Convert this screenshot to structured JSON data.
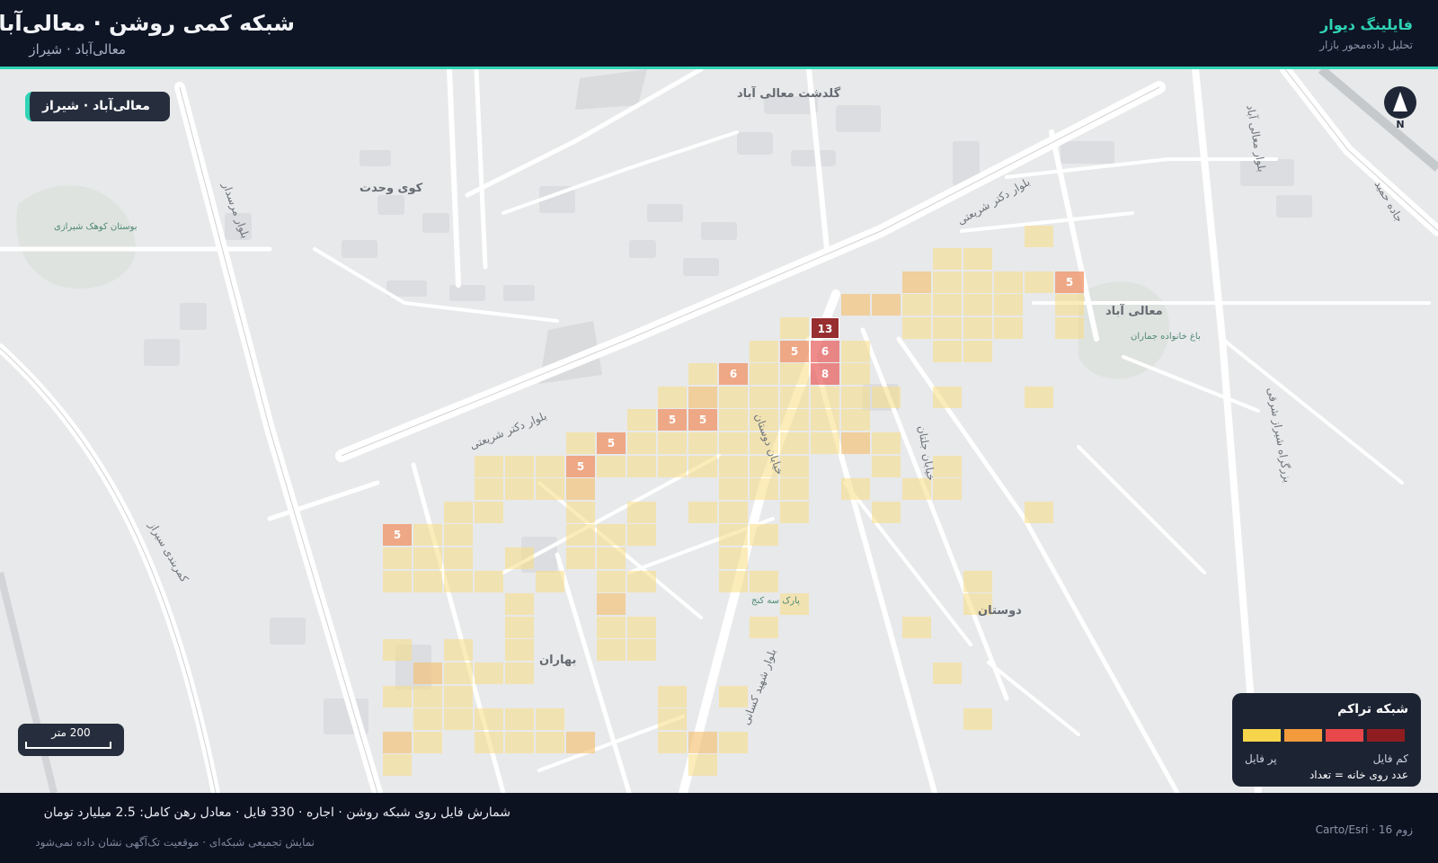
{
  "header": {
    "title": "شبکه کمی روشن · معالی‌آباد",
    "subtitle": "معالی‌آباد · شیراز",
    "brand": "فایلینگ دیوار",
    "brand_tagline": "تحلیل داده‌محور بازار"
  },
  "map": {
    "location_badge": "معالی‌آباد · شیراز",
    "north_label": "N",
    "scale_label": "200 متر",
    "place_labels": [
      {
        "text": "گلدشت معالی آباد",
        "kind": "big"
      },
      {
        "text": "کوی وحدت",
        "kind": "big"
      },
      {
        "text": "معالی آباد",
        "kind": "big"
      },
      {
        "text": "دوستان",
        "kind": "big"
      },
      {
        "text": "بهاران",
        "kind": "big"
      },
      {
        "text": "بوستان کوهک شیرازی",
        "kind": "park"
      },
      {
        "text": "باغ خانواده جماران",
        "kind": "park"
      },
      {
        "text": "پارک سه کنج",
        "kind": "park"
      },
      {
        "text": "بلوار دکتر شریعتی",
        "kind": "street"
      },
      {
        "text": "کمربندی سیراز",
        "kind": "street"
      },
      {
        "text": "بلوار مرسدار",
        "kind": "street"
      },
      {
        "text": "بلوار شهید کسانی",
        "kind": "street"
      },
      {
        "text": "خیابان دوستان",
        "kind": "street"
      },
      {
        "text": "خیابان جلتان",
        "kind": "street"
      },
      {
        "text": "بزرگراه شیراز شرقی",
        "kind": "street"
      },
      {
        "text": "بلوار معالی آباد",
        "kind": "street"
      },
      {
        "text": "بلوار دکتر شریعتی",
        "kind": "street"
      },
      {
        "text": "جاده حمید",
        "kind": "street"
      }
    ],
    "grid_cells": [
      {
        "col": 34,
        "row": 6,
        "level": 1
      },
      {
        "col": 31,
        "row": 7,
        "level": 1
      },
      {
        "col": 32,
        "row": 7,
        "level": 1
      },
      {
        "col": 30,
        "row": 8,
        "level": 2
      },
      {
        "col": 31,
        "row": 8,
        "level": 1
      },
      {
        "col": 32,
        "row": 8,
        "level": 1
      },
      {
        "col": 33,
        "row": 8,
        "level": 1
      },
      {
        "col": 34,
        "row": 8,
        "level": 1
      },
      {
        "col": 35,
        "row": 8,
        "level": 3,
        "count": 5
      },
      {
        "col": 28,
        "row": 9,
        "level": 2
      },
      {
        "col": 29,
        "row": 9,
        "level": 2
      },
      {
        "col": 30,
        "row": 9,
        "level": 1
      },
      {
        "col": 31,
        "row": 9,
        "level": 1
      },
      {
        "col": 32,
        "row": 9,
        "level": 1
      },
      {
        "col": 33,
        "row": 9,
        "level": 1
      },
      {
        "col": 35,
        "row": 9,
        "level": 1
      },
      {
        "col": 26,
        "row": 10,
        "level": 1
      },
      {
        "col": 27,
        "row": 10,
        "level": 5,
        "count": 13
      },
      {
        "col": 30,
        "row": 10,
        "level": 1
      },
      {
        "col": 31,
        "row": 10,
        "level": 1
      },
      {
        "col": 32,
        "row": 10,
        "level": 1
      },
      {
        "col": 33,
        "row": 10,
        "level": 1
      },
      {
        "col": 35,
        "row": 10,
        "level": 1
      },
      {
        "col": 25,
        "row": 11,
        "level": 1
      },
      {
        "col": 26,
        "row": 11,
        "level": 3,
        "count": 5
      },
      {
        "col": 27,
        "row": 11,
        "level": 4,
        "count": 6
      },
      {
        "col": 28,
        "row": 11,
        "level": 1
      },
      {
        "col": 31,
        "row": 11,
        "level": 1
      },
      {
        "col": 32,
        "row": 11,
        "level": 1
      },
      {
        "col": 23,
        "row": 12,
        "level": 1
      },
      {
        "col": 24,
        "row": 12,
        "level": 3,
        "count": 6
      },
      {
        "col": 25,
        "row": 12,
        "level": 1
      },
      {
        "col": 26,
        "row": 12,
        "level": 1
      },
      {
        "col": 27,
        "row": 12,
        "level": 4,
        "count": 8
      },
      {
        "col": 28,
        "row": 12,
        "level": 1
      },
      {
        "col": 22,
        "row": 13,
        "level": 1
      },
      {
        "col": 23,
        "row": 13,
        "level": 2
      },
      {
        "col": 24,
        "row": 13,
        "level": 1
      },
      {
        "col": 25,
        "row": 13,
        "level": 1
      },
      {
        "col": 26,
        "row": 13,
        "level": 1
      },
      {
        "col": 27,
        "row": 13,
        "level": 1
      },
      {
        "col": 28,
        "row": 13,
        "level": 1
      },
      {
        "col": 29,
        "row": 13,
        "level": 1
      },
      {
        "col": 31,
        "row": 13,
        "level": 1
      },
      {
        "col": 34,
        "row": 13,
        "level": 1
      },
      {
        "col": 21,
        "row": 14,
        "level": 1
      },
      {
        "col": 22,
        "row": 14,
        "level": 3,
        "count": 5
      },
      {
        "col": 23,
        "row": 14,
        "level": 3,
        "count": 5
      },
      {
        "col": 24,
        "row": 14,
        "level": 1
      },
      {
        "col": 25,
        "row": 14,
        "level": 1
      },
      {
        "col": 26,
        "row": 14,
        "level": 1
      },
      {
        "col": 27,
        "row": 14,
        "level": 1
      },
      {
        "col": 28,
        "row": 14,
        "level": 1
      },
      {
        "col": 19,
        "row": 15,
        "level": 1
      },
      {
        "col": 20,
        "row": 15,
        "level": 3,
        "count": 5
      },
      {
        "col": 21,
        "row": 15,
        "level": 1
      },
      {
        "col": 22,
        "row": 15,
        "level": 1
      },
      {
        "col": 23,
        "row": 15,
        "level": 1
      },
      {
        "col": 24,
        "row": 15,
        "level": 1
      },
      {
        "col": 25,
        "row": 15,
        "level": 1
      },
      {
        "col": 26,
        "row": 15,
        "level": 1
      },
      {
        "col": 27,
        "row": 15,
        "level": 1
      },
      {
        "col": 28,
        "row": 15,
        "level": 2
      },
      {
        "col": 29,
        "row": 15,
        "level": 1
      },
      {
        "col": 16,
        "row": 16,
        "level": 1
      },
      {
        "col": 17,
        "row": 16,
        "level": 1
      },
      {
        "col": 18,
        "row": 16,
        "level": 1
      },
      {
        "col": 19,
        "row": 16,
        "level": 3,
        "count": 5
      },
      {
        "col": 20,
        "row": 16,
        "level": 1
      },
      {
        "col": 21,
        "row": 16,
        "level": 1
      },
      {
        "col": 22,
        "row": 16,
        "level": 1
      },
      {
        "col": 23,
        "row": 16,
        "level": 1
      },
      {
        "col": 24,
        "row": 16,
        "level": 1
      },
      {
        "col": 25,
        "row": 16,
        "level": 1
      },
      {
        "col": 26,
        "row": 16,
        "level": 1
      },
      {
        "col": 29,
        "row": 16,
        "level": 1
      },
      {
        "col": 31,
        "row": 16,
        "level": 1
      },
      {
        "col": 16,
        "row": 17,
        "level": 1
      },
      {
        "col": 17,
        "row": 17,
        "level": 1
      },
      {
        "col": 18,
        "row": 17,
        "level": 1
      },
      {
        "col": 19,
        "row": 17,
        "level": 2
      },
      {
        "col": 24,
        "row": 17,
        "level": 1
      },
      {
        "col": 25,
        "row": 17,
        "level": 1
      },
      {
        "col": 26,
        "row": 17,
        "level": 1
      },
      {
        "col": 28,
        "row": 17,
        "level": 1
      },
      {
        "col": 30,
        "row": 17,
        "level": 1
      },
      {
        "col": 31,
        "row": 17,
        "level": 1
      },
      {
        "col": 15,
        "row": 18,
        "level": 1
      },
      {
        "col": 16,
        "row": 18,
        "level": 1
      },
      {
        "col": 19,
        "row": 18,
        "level": 1
      },
      {
        "col": 21,
        "row": 18,
        "level": 1
      },
      {
        "col": 23,
        "row": 18,
        "level": 1
      },
      {
        "col": 24,
        "row": 18,
        "level": 1
      },
      {
        "col": 26,
        "row": 18,
        "level": 1
      },
      {
        "col": 29,
        "row": 18,
        "level": 1
      },
      {
        "col": 34,
        "row": 18,
        "level": 1
      },
      {
        "col": 13,
        "row": 19,
        "level": 3,
        "count": 5
      },
      {
        "col": 14,
        "row": 19,
        "level": 1
      },
      {
        "col": 15,
        "row": 19,
        "level": 1
      },
      {
        "col": 19,
        "row": 19,
        "level": 1
      },
      {
        "col": 20,
        "row": 19,
        "level": 1
      },
      {
        "col": 21,
        "row": 19,
        "level": 1
      },
      {
        "col": 24,
        "row": 19,
        "level": 1
      },
      {
        "col": 25,
        "row": 19,
        "level": 1
      },
      {
        "col": 13,
        "row": 20,
        "level": 1
      },
      {
        "col": 14,
        "row": 20,
        "level": 1
      },
      {
        "col": 15,
        "row": 20,
        "level": 1
      },
      {
        "col": 17,
        "row": 20,
        "level": 1
      },
      {
        "col": 19,
        "row": 20,
        "level": 1
      },
      {
        "col": 20,
        "row": 20,
        "level": 1
      },
      {
        "col": 24,
        "row": 20,
        "level": 1
      },
      {
        "col": 13,
        "row": 21,
        "level": 1
      },
      {
        "col": 14,
        "row": 21,
        "level": 1
      },
      {
        "col": 15,
        "row": 21,
        "level": 1
      },
      {
        "col": 16,
        "row": 21,
        "level": 1
      },
      {
        "col": 18,
        "row": 21,
        "level": 1
      },
      {
        "col": 20,
        "row": 21,
        "level": 1
      },
      {
        "col": 21,
        "row": 21,
        "level": 1
      },
      {
        "col": 24,
        "row": 21,
        "level": 1
      },
      {
        "col": 25,
        "row": 21,
        "level": 1
      },
      {
        "col": 32,
        "row": 21,
        "level": 1
      },
      {
        "col": 17,
        "row": 22,
        "level": 1
      },
      {
        "col": 20,
        "row": 22,
        "level": 2
      },
      {
        "col": 26,
        "row": 22,
        "level": 1
      },
      {
        "col": 32,
        "row": 22,
        "level": 1
      },
      {
        "col": 17,
        "row": 23,
        "level": 1
      },
      {
        "col": 20,
        "row": 23,
        "level": 1
      },
      {
        "col": 21,
        "row": 23,
        "level": 1
      },
      {
        "col": 25,
        "row": 23,
        "level": 1
      },
      {
        "col": 30,
        "row": 23,
        "level": 1
      },
      {
        "col": 13,
        "row": 24,
        "level": 1
      },
      {
        "col": 15,
        "row": 24,
        "level": 1
      },
      {
        "col": 17,
        "row": 24,
        "level": 1
      },
      {
        "col": 20,
        "row": 24,
        "level": 1
      },
      {
        "col": 21,
        "row": 24,
        "level": 1
      },
      {
        "col": 14,
        "row": 25,
        "level": 2
      },
      {
        "col": 15,
        "row": 25,
        "level": 1
      },
      {
        "col": 16,
        "row": 25,
        "level": 1
      },
      {
        "col": 17,
        "row": 25,
        "level": 1
      },
      {
        "col": 31,
        "row": 25,
        "level": 1
      },
      {
        "col": 13,
        "row": 26,
        "level": 1
      },
      {
        "col": 14,
        "row": 26,
        "level": 1
      },
      {
        "col": 15,
        "row": 26,
        "level": 1
      },
      {
        "col": 22,
        "row": 26,
        "level": 1
      },
      {
        "col": 24,
        "row": 26,
        "level": 1
      },
      {
        "col": 14,
        "row": 27,
        "level": 1
      },
      {
        "col": 15,
        "row": 27,
        "level": 1
      },
      {
        "col": 16,
        "row": 27,
        "level": 1
      },
      {
        "col": 17,
        "row": 27,
        "level": 1
      },
      {
        "col": 18,
        "row": 27,
        "level": 1
      },
      {
        "col": 22,
        "row": 27,
        "level": 1
      },
      {
        "col": 32,
        "row": 27,
        "level": 1
      },
      {
        "col": 13,
        "row": 28,
        "level": 2
      },
      {
        "col": 14,
        "row": 28,
        "level": 1
      },
      {
        "col": 16,
        "row": 28,
        "level": 1
      },
      {
        "col": 17,
        "row": 28,
        "level": 1
      },
      {
        "col": 18,
        "row": 28,
        "level": 1
      },
      {
        "col": 19,
        "row": 28,
        "level": 2
      },
      {
        "col": 22,
        "row": 28,
        "level": 1
      },
      {
        "col": 23,
        "row": 28,
        "level": 2
      },
      {
        "col": 24,
        "row": 28,
        "level": 1
      },
      {
        "col": 13,
        "row": 29,
        "level": 1
      },
      {
        "col": 23,
        "row": 29,
        "level": 1
      }
    ]
  },
  "legend": {
    "title": "شبکه تراکم",
    "low_label": "کم فایل",
    "high_label": "پر فایل",
    "note": "عدد روی خانه = تعداد",
    "colors": [
      "#f6d54a",
      "#f39a3d",
      "#e8484a",
      "#8f1d20"
    ]
  },
  "footer": {
    "summary": "شمارش فایل روی شبکه روشن · اجاره · 330 فایل · معادل رهن کامل: 2.5 میلیارد تومان",
    "note": "نمایش تجمیعی شبکه‌ای · موقعیت تک‌آگهی نشان داده نمی‌شود",
    "attribution": "زوم 16 · Carto/Esri"
  },
  "colors": {
    "accent": "#2fd3b5",
    "level_1": "#f5dc8a",
    "level_2": "#f4c07a",
    "level_3": "#ef9a70",
    "level_4": "#e86a6a",
    "level_5": "#8f1d20"
  }
}
